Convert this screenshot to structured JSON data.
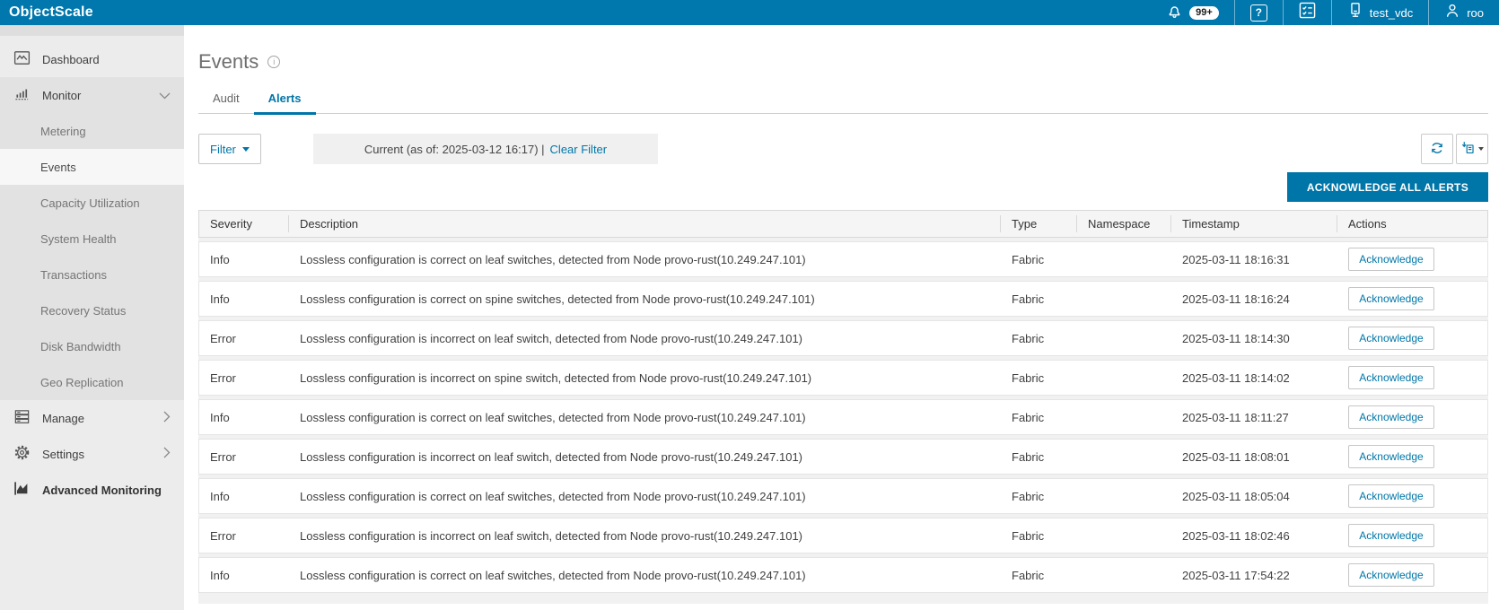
{
  "colors": {
    "brand_blue": "#0077ad",
    "accent_blue": "#0076a8"
  },
  "topbar": {
    "app_title": "ObjectScale",
    "notifications_badge": "99+",
    "vdc_name": "test_vdc",
    "username": "roo"
  },
  "sidebar": {
    "dashboard_label": "Dashboard",
    "monitor_label": "Monitor",
    "monitor_items": [
      "Metering",
      "Events",
      "Capacity Utilization",
      "System Health",
      "Transactions",
      "Recovery Status",
      "Disk Bandwidth",
      "Geo Replication"
    ],
    "active_item": "Events",
    "manage_label": "Manage",
    "settings_label": "Settings",
    "advanced_monitoring_label": "Advanced Monitoring"
  },
  "main": {
    "page_title": "Events",
    "tabs": {
      "audit": "Audit",
      "alerts": "Alerts",
      "active": "Alerts"
    },
    "filter_button_label": "Filter",
    "filter_status_text": "Current (as of: 2025-03-12 16:17) |",
    "clear_filter_label": "Clear Filter",
    "acknowledge_all_label": "ACKNOWLEDGE ALL ALERTS",
    "table": {
      "columns": [
        "Severity",
        "Description",
        "Type",
        "Namespace",
        "Timestamp",
        "Actions"
      ],
      "action_label": "Acknowledge",
      "rows": [
        {
          "severity": "Info",
          "description": "Lossless configuration is correct on leaf switches, detected from Node provo-rust(10.249.247.101)",
          "type": "Fabric",
          "namespace": "",
          "timestamp": "2025-03-11 18:16:31"
        },
        {
          "severity": "Info",
          "description": "Lossless configuration is correct on spine switches, detected from Node provo-rust(10.249.247.101)",
          "type": "Fabric",
          "namespace": "",
          "timestamp": "2025-03-11 18:16:24"
        },
        {
          "severity": "Error",
          "description": "Lossless configuration is incorrect on leaf switch, detected from Node provo-rust(10.249.247.101)",
          "type": "Fabric",
          "namespace": "",
          "timestamp": "2025-03-11 18:14:30"
        },
        {
          "severity": "Error",
          "description": "Lossless configuration is incorrect on spine switch, detected from Node provo-rust(10.249.247.101)",
          "type": "Fabric",
          "namespace": "",
          "timestamp": "2025-03-11 18:14:02"
        },
        {
          "severity": "Info",
          "description": "Lossless configuration is correct on leaf switches, detected from Node provo-rust(10.249.247.101)",
          "type": "Fabric",
          "namespace": "",
          "timestamp": "2025-03-11 18:11:27"
        },
        {
          "severity": "Error",
          "description": "Lossless configuration is incorrect on leaf switch, detected from Node provo-rust(10.249.247.101)",
          "type": "Fabric",
          "namespace": "",
          "timestamp": "2025-03-11 18:08:01"
        },
        {
          "severity": "Info",
          "description": "Lossless configuration is correct on leaf switches, detected from Node provo-rust(10.249.247.101)",
          "type": "Fabric",
          "namespace": "",
          "timestamp": "2025-03-11 18:05:04"
        },
        {
          "severity": "Error",
          "description": "Lossless configuration is incorrect on leaf switch, detected from Node provo-rust(10.249.247.101)",
          "type": "Fabric",
          "namespace": "",
          "timestamp": "2025-03-11 18:02:46"
        },
        {
          "severity": "Info",
          "description": "Lossless configuration is correct on leaf switches, detected from Node provo-rust(10.249.247.101)",
          "type": "Fabric",
          "namespace": "",
          "timestamp": "2025-03-11 17:54:22"
        }
      ]
    }
  }
}
